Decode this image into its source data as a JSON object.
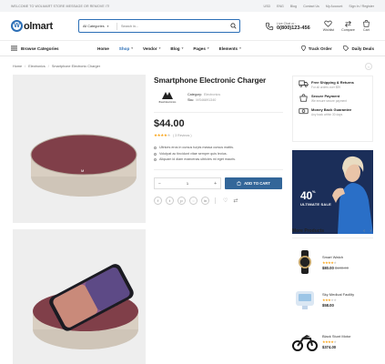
{
  "topbar": {
    "welcome": "Welcome to Wolmart Store message or remove it!",
    "currency": "USD",
    "language": "ENG",
    "links": [
      "Blog",
      "Contact Us",
      "My Account",
      "Sign In / Register"
    ]
  },
  "header": {
    "logo_letter": "W",
    "logo_text": "olmart",
    "search_category": "All Categories",
    "search_placeholder": "Search in...",
    "contact_label": "Live Chat or :",
    "contact_phone": "0(800)123-456",
    "icons": [
      {
        "name": "wishlist",
        "label": "Wishlist"
      },
      {
        "name": "compare",
        "label": "Compare"
      },
      {
        "name": "cart",
        "label": "Cart"
      }
    ]
  },
  "nav": {
    "browse": "Browse Categories",
    "items": [
      "Home",
      "Shop",
      "Vendor",
      "Blog",
      "Pages",
      "Elements"
    ],
    "active": "Shop",
    "track": "Track Order",
    "deals": "Daily Deals"
  },
  "breadcrumb": [
    "Home",
    "Electronics",
    "Smartphone Electronic Charger"
  ],
  "product": {
    "title": "Smartphone Electronic Charger",
    "brand_logo_text": "Brand Electronics",
    "category_label": "Category:",
    "category": "Electronics",
    "sku_label": "Sku:",
    "sku": "MS46891340",
    "price": "$44.00",
    "rating": 4,
    "reviews": "( 3 Reviews )",
    "bullets": [
      "Ultrices eros in cursus turpis massa cursus mattis.",
      "Volutpat ac tincidunt vitae semper quis lectus.",
      "Aliquam id diam maecenas ultricies mi eget mauris."
    ],
    "qty": "1",
    "add_to_cart": "ADD TO CART"
  },
  "services": [
    {
      "icon": "truck-icon",
      "title": "Free Shipping & Returns",
      "sub": "For all orders over $99"
    },
    {
      "icon": "bag-icon",
      "title": "Secure Payment",
      "sub": "We ensure secure payment"
    },
    {
      "icon": "money-icon",
      "title": "Money Back Guarantee",
      "sub": "Any back within 30 days"
    }
  ],
  "banner": {
    "percent": "40",
    "sale": "ULTIMATE SALE"
  },
  "more": {
    "title": "More Products",
    "items": [
      {
        "name": "Smart Watch",
        "price": "$80.00",
        "old": "$100.00",
        "rating": 4
      },
      {
        "name": "Sky Medical Facility",
        "price": "$58.00",
        "old": "",
        "rating": 3
      },
      {
        "name": "Black Stunt Motor",
        "price": "$374.00",
        "old": "",
        "rating": 4
      }
    ]
  },
  "colors": {
    "accent": "#336699",
    "link": "#2c6fb6",
    "star": "#f9a51a",
    "banner": "#1b2e59"
  }
}
